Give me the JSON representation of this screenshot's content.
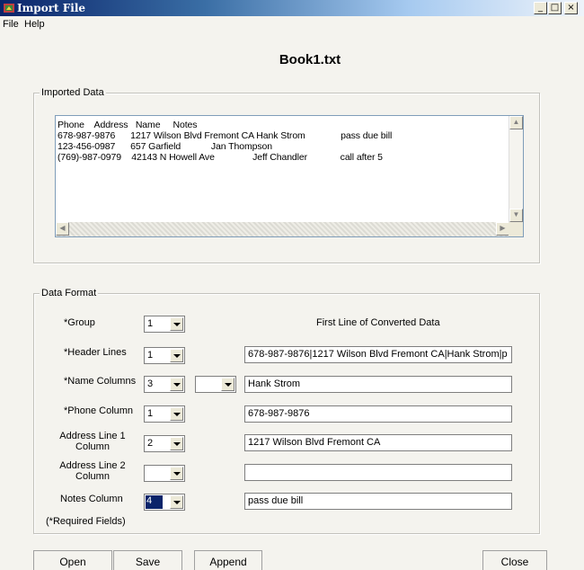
{
  "window": {
    "title": "Import File",
    "min_glyph": "_",
    "max_glyph": "□",
    "close_glyph": "×",
    "icon": "app-icon"
  },
  "menu": {
    "file": "File",
    "help": "Help"
  },
  "document_title": "Book1.txt",
  "imported": {
    "legend": "Imported Data",
    "lines": [
      "Phone    Address   Name     Notes",
      "678-987-9876      1217 Wilson Blvd Fremont CA Hank Strom              pass due bill",
      "123-456-0987      657 Garfield            Jan Thompson",
      "(769)-987-0979    42143 N Howell Ave               Jeff Chandler             call after 5"
    ]
  },
  "format": {
    "legend": "Data Format",
    "first_line_label": "First Line of Converted Data",
    "required_note": "(*Required Fields)",
    "rows": [
      {
        "label": "*Group",
        "value": "1",
        "text": null
      },
      {
        "label": "*Header Lines",
        "value": "1",
        "text": "678-987-9876|1217 Wilson Blvd Fremont CA|Hank Strom|p"
      },
      {
        "label": "*Name Columns",
        "value": "3",
        "value2": "",
        "text": "Hank Strom"
      },
      {
        "label": "*Phone Column",
        "value": "1",
        "text": "678-987-9876"
      },
      {
        "label": "Address Line 1 Column",
        "label_a": "Address Line 1",
        "label_b": "Column",
        "value": "2",
        "text": "1217 Wilson Blvd Fremont CA"
      },
      {
        "label": "Address Line 2 Column",
        "label_a": "Address Line 2",
        "label_b": "Column",
        "value": "",
        "text": ""
      },
      {
        "label": "Notes Column",
        "value": "4",
        "text": "pass due bill"
      }
    ]
  },
  "buttons": {
    "open": "Open",
    "save": "Save",
    "append": "Append",
    "close": "Close"
  }
}
